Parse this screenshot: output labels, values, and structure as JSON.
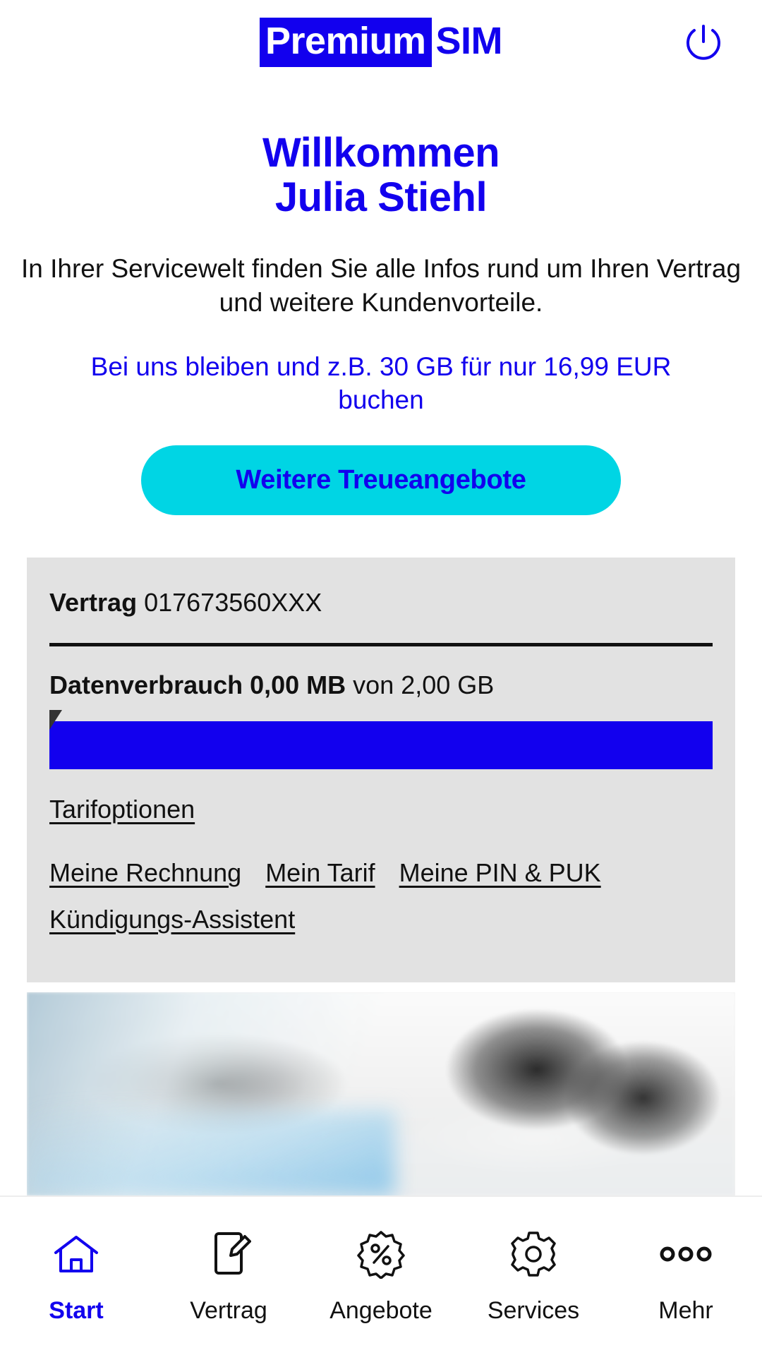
{
  "header": {
    "logo_first": "Premium",
    "logo_second": "SIM",
    "power_icon": "power-icon",
    "accent_blue": "#1200EE",
    "accent_cyan": "#00D5E4"
  },
  "hero": {
    "welcome_line1": "Willkommen",
    "welcome_line2": "Julia Stiehl",
    "intro": "In Ihrer Servicewelt finden Sie alle Infos rund um Ihren Vertrag und weitere Kundenvorteile.",
    "promo": "Bei uns bleiben und z.B. 30 GB für nur 16,99 EUR buchen",
    "cta_label": "Weitere Treueangebote"
  },
  "contract_card": {
    "contract_label": "Vertrag",
    "contract_number": "017673560XXX",
    "usage_label": "Datenverbrauch 0,00 MB",
    "usage_total": "von 2,00 GB",
    "usage_used_value": "0,00 MB",
    "usage_total_value": "2,00 GB",
    "progress_percent": 100,
    "links": [
      {
        "label": "Tarifoptionen"
      },
      {
        "label": "Meine Rechnung"
      },
      {
        "label": "Mein Tarif"
      },
      {
        "label": "Meine PIN & PUK"
      },
      {
        "label": "Kündigungs-Assistent"
      }
    ]
  },
  "banner": {
    "alt": "Zwei lachende Frauen, Schwarz-Weiß-Foto"
  },
  "bottom_nav": {
    "items": [
      {
        "label": "Start",
        "icon": "home-icon",
        "active": true
      },
      {
        "label": "Vertrag",
        "icon": "document-edit-icon",
        "active": false
      },
      {
        "label": "Angebote",
        "icon": "percent-badge-icon",
        "active": false
      },
      {
        "label": "Services",
        "icon": "gear-icon",
        "active": false
      },
      {
        "label": "Mehr",
        "icon": "more-dots-icon",
        "active": false
      }
    ]
  }
}
